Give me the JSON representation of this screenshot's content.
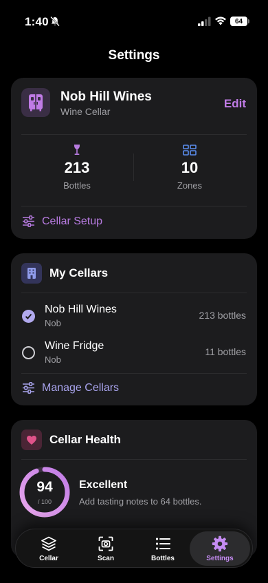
{
  "status_bar": {
    "time": "1:40",
    "battery": "64"
  },
  "page": {
    "title": "Settings"
  },
  "cellar_card": {
    "name": "Nob Hill Wines",
    "type": "Wine Cellar",
    "edit_label": "Edit",
    "stats": {
      "bottles": {
        "value": "213",
        "label": "Bottles"
      },
      "zones": {
        "value": "10",
        "label": "Zones"
      }
    },
    "setup_label": "Cellar Setup"
  },
  "my_cellars": {
    "title": "My Cellars",
    "items": [
      {
        "name": "Nob Hill Wines",
        "sub": "Nob",
        "count": "213 bottles",
        "selected": true
      },
      {
        "name": "Wine Fridge",
        "sub": "Nob",
        "count": "11 bottles",
        "selected": false
      }
    ],
    "manage_label": "Manage Cellars"
  },
  "health": {
    "title": "Cellar Health",
    "score": "94",
    "max": "/ 100",
    "score_fraction": 0.94,
    "status": "Excellent",
    "description": "Add tasting notes to 64 bottles."
  },
  "tabs": [
    {
      "label": "Cellar",
      "icon": "layers-icon",
      "active": false
    },
    {
      "label": "Scan",
      "icon": "scan-icon",
      "active": false
    },
    {
      "label": "Bottles",
      "icon": "list-icon",
      "active": false
    },
    {
      "label": "Settings",
      "icon": "gear-icon",
      "active": true
    }
  ],
  "colors": {
    "accent_purple": "#c07be6",
    "accent_lavender": "#a8a3ec",
    "card_bg": "#1c1c1e",
    "health_pink": "#e0538a"
  }
}
